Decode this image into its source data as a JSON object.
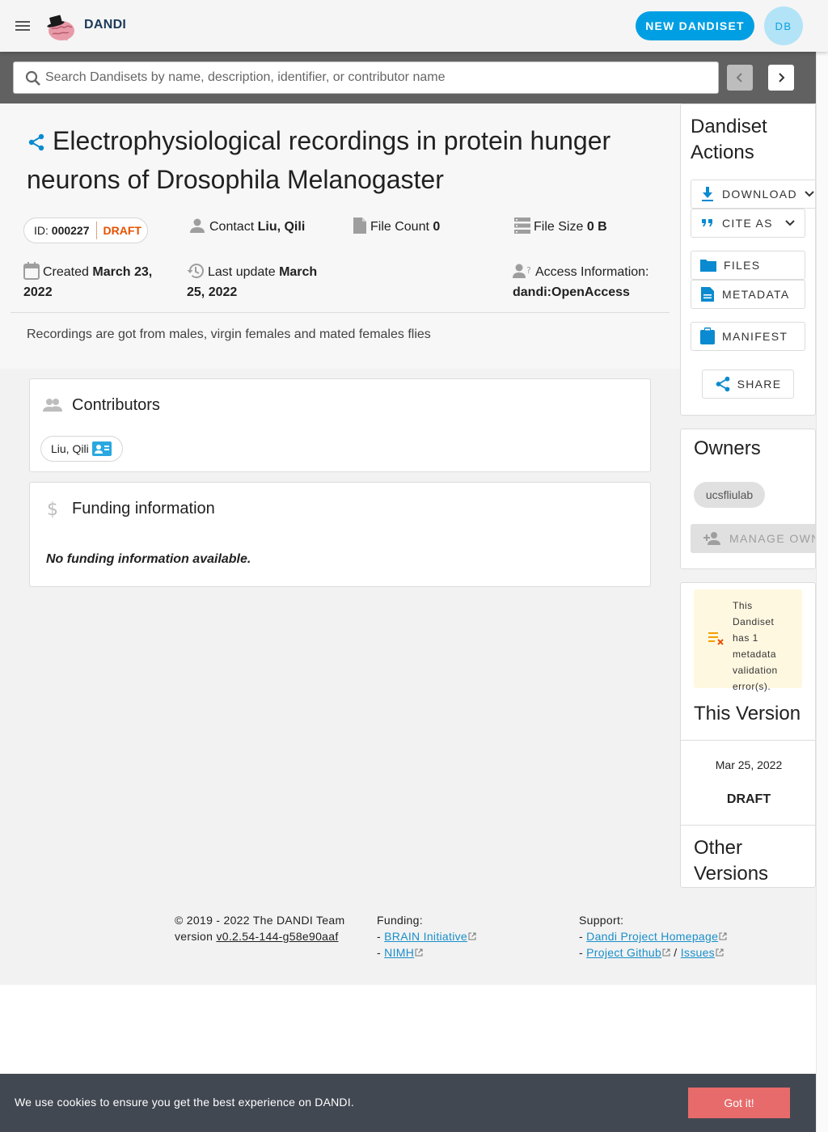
{
  "appbar": {
    "brand": "DANDI",
    "new_button": "NEW DANDISET",
    "avatar_initials": "DB",
    "accent_color": "#009fe3"
  },
  "search": {
    "placeholder": "Search Dandisets by name, description, identifier, or contributor name"
  },
  "dandiset": {
    "title": "Electrophysiological recordings in protein hunger neurons of Drosophila Melanogaster",
    "id_label": "ID:",
    "id": "000227",
    "status": "DRAFT",
    "contact_label": "Contact",
    "contact": "Liu, Qili",
    "file_count_label": "File Count",
    "file_count": "0",
    "file_size_label": "File Size",
    "file_size": "0 B",
    "created_label": "Created",
    "created_a": "March 23,",
    "created_b": "2022",
    "updated_label": "Last update",
    "updated_a": "March",
    "updated_b": "25, 2022",
    "access_label": "Access Information:",
    "access": "dandi:OpenAccess",
    "description": "Recordings are got from males, virgin females and mated females flies"
  },
  "contributors": {
    "title": "Contributors",
    "items": [
      "Liu, Qili"
    ]
  },
  "funding": {
    "title": "Funding information",
    "empty": "No funding information available."
  },
  "actions": {
    "title_a": "Dandiset",
    "title_b": "Actions",
    "download": "DOWNLOAD",
    "cite": "CITE AS",
    "files": "FILES",
    "metadata": "METADATA",
    "manifest": "MANIFEST",
    "share": "SHARE"
  },
  "owners": {
    "title": "Owners",
    "items": [
      "ucsfliulab"
    ],
    "manage": "MANAGE OWNERS"
  },
  "version": {
    "warning": "This Dandiset has 1 metadata validation error(s).",
    "title": "This Version",
    "date": "Mar 25, 2022",
    "name": "DRAFT",
    "other_title_a": "Other",
    "other_title_b": "Versions"
  },
  "footer": {
    "copyright": "© 2019 - 2022 The DANDI Team",
    "version_label": "version",
    "version": "v0.2.54-144-g58e90aaf",
    "funding_label": "Funding:",
    "funding_links": [
      "BRAIN Initiative",
      "NIMH"
    ],
    "support_label": "Support:",
    "support_homepage": "Dandi Project Homepage",
    "support_github": "Project Github",
    "support_issues": "Issues",
    "dash": "-",
    "slash": "/"
  },
  "cookie": {
    "text": "We use cookies to ensure you get the best experience on DANDI.",
    "button": "Got it!"
  }
}
